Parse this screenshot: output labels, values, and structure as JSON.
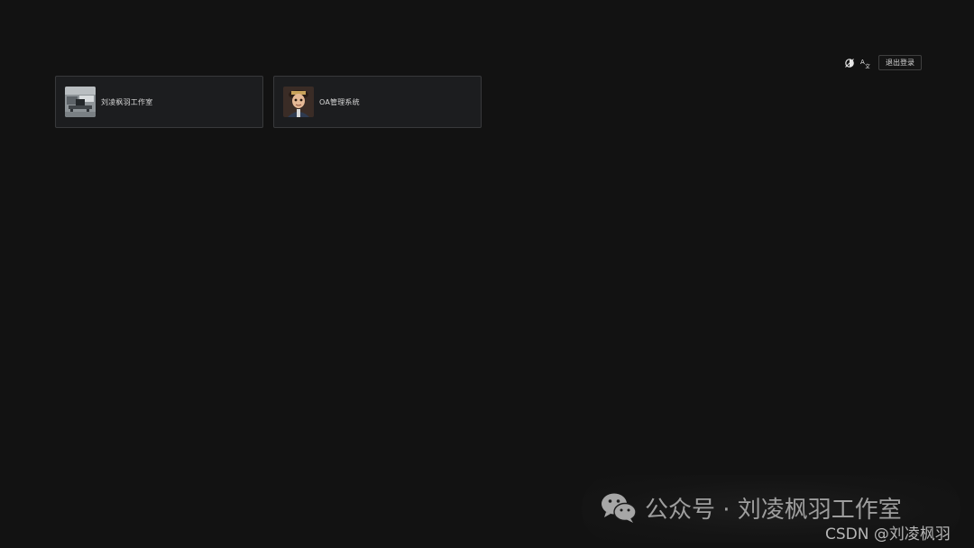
{
  "toolbar": {
    "icons": [
      "theme-toggle-icon",
      "language-switch-icon"
    ],
    "logout_label": "退出登录"
  },
  "apps": [
    {
      "name": "刘凌枫羽工作室",
      "thumbnail": "office-photo"
    },
    {
      "name": "OA管理系统",
      "thumbnail": "cartoon-avatar"
    }
  ],
  "watermark": {
    "wechat_text": "公众号 · 刘凌枫羽工作室",
    "csdn_text": "CSDN @刘凌枫羽"
  },
  "colors": {
    "background": "#121212",
    "card_background": "#1c1d1f",
    "card_border": "#38393b",
    "text": "#d9d9d9"
  }
}
